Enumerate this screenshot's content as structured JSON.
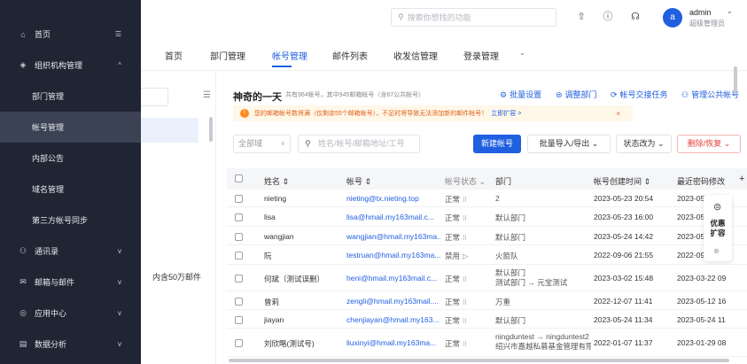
{
  "search": {
    "placeholder": "搜索你想找的功能"
  },
  "user": {
    "avatar_letter": "a",
    "name": "admin",
    "role": "超级管理员"
  },
  "sidebar": {
    "items": [
      {
        "icon": "home-icon",
        "label": "首页",
        "extra": "☰"
      },
      {
        "icon": "org-icon",
        "label": "组织机构管理",
        "chevron": "^"
      },
      {
        "label": "部门管理"
      },
      {
        "label": "帐号管理"
      },
      {
        "label": "内部公告"
      },
      {
        "label": "域名管理"
      },
      {
        "label": "第三方帐号同步"
      },
      {
        "icon": "contacts-icon",
        "label": "通讯录",
        "chevron": "v"
      },
      {
        "icon": "mail-icon",
        "label": "邮箱与邮件",
        "chevron": "v"
      },
      {
        "icon": "apps-icon",
        "label": "应用中心",
        "chevron": "v"
      },
      {
        "icon": "analytics-icon",
        "label": "数据分析",
        "chevron": "v"
      }
    ]
  },
  "tabs": [
    "首页",
    "部门管理",
    "帐号管理",
    "邮件列表",
    "收发信管理",
    "登录管理"
  ],
  "tree": {
    "quota_text": "内含50万邮件"
  },
  "org": {
    "title": "神奇的一天",
    "stats": "共有964帐号，其中945邮箱帐号（含67公共帐号）"
  },
  "actions": {
    "batch_settings": "批量设置",
    "adjust_dept": "调整部门",
    "handover": "帐号交接任务",
    "public": "管理公共帐号"
  },
  "warning": {
    "text": "您的邮箱帐号数将满（仅剩余55个邮箱帐号），不足时将导致无法添加新的邮件帐号！",
    "link": "立即扩容 >",
    "close": "×"
  },
  "filters": {
    "domain": "全部域",
    "domain_caret": "v",
    "search_placeholder": "姓名/帐号/邮箱地址/工号"
  },
  "buttons": {
    "new_account": "新建帐号",
    "import_export": "批量导入/导出",
    "status_change": "状态改为",
    "delete_restore": "删除/恢复"
  },
  "table": {
    "headers": {
      "name": "姓名 ⇕",
      "account": "帐号 ⇕",
      "status": "帐号状态 ⌄",
      "dept": "部门",
      "created": "帐号创建时间 ⇕",
      "pwd": "最近密码修改",
      "plus": "+"
    },
    "rows": [
      {
        "name": "nieting",
        "account": "nieting@tx.nieting.top",
        "status": "正常",
        "pipe": "II",
        "dept": "2",
        "created": "2023-05-23 20:54",
        "pwd": "2023-05"
      },
      {
        "name": "lisa",
        "account": "lisa@hmail.my163mail.c...",
        "status": "正常",
        "pipe": "II",
        "dept": "默认部门",
        "created": "2023-05-23 16:00",
        "pwd": "2023-05"
      },
      {
        "name": "wangjian",
        "account": "wangjian@hmail.my163ma...",
        "status": "正常",
        "pipe": "II",
        "dept": "默认部门",
        "created": "2023-05-24 14:42",
        "pwd": "2023-05"
      },
      {
        "name": "阮",
        "account": "testruan@hmail.my163ma...",
        "status": "禁用",
        "pipe": "▷",
        "dept": "火箭队",
        "created": "2022-09-06 21:55",
        "pwd": "2022-09"
      },
      {
        "name": "何斌（测试误删）",
        "account": "heni@hmail.my163mail.c...",
        "status": "正常",
        "pipe": "II",
        "dept": "默认部门",
        "dept2": "测试部门 → 元宝测试",
        "created": "2023-03-02 15:48",
        "pwd": "2023-03-22 09"
      },
      {
        "name": "曾莉",
        "account": "zengli@hmail.my163mail....",
        "status": "正常",
        "pipe": "II",
        "dept": "万重",
        "created": "2022-12-07 11:41",
        "pwd": "2023-05-12 16"
      },
      {
        "name": "jiayan",
        "account": "chenjiayan@hmail.my163...",
        "status": "正常",
        "pipe": "II",
        "dept": "默认部门",
        "created": "2023-05-24 11:34",
        "pwd": "2023-05-24 11"
      },
      {
        "name": "刘欣略(测试号)",
        "account": "liuxinyi@hmail.my163ma...",
        "status": "正常",
        "pipe": "II",
        "dept": "ningduntest → ningduntest2",
        "dept2": "绍兴市嘉越私募基金管理有限...",
        "created": "2022-01-07 11:37",
        "pwd": "2023-01-29 08"
      }
    ]
  },
  "promo": {
    "text": "优惠扩容",
    "close": "⊗"
  }
}
